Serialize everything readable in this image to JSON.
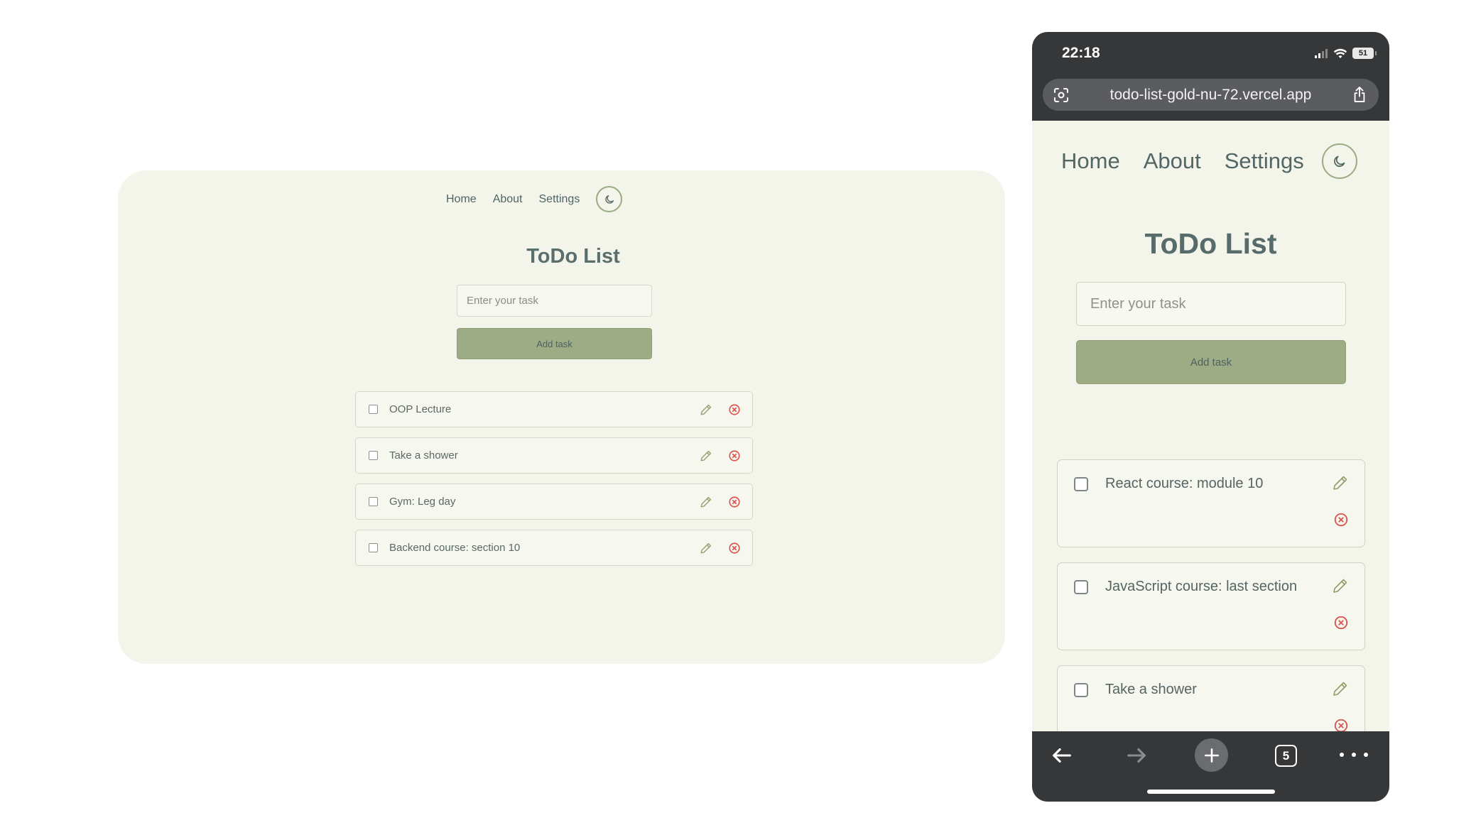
{
  "desktop": {
    "nav": {
      "home": "Home",
      "about": "About",
      "settings": "Settings"
    },
    "theme_toggle_icon": "moon-icon",
    "title": "ToDo List",
    "input_placeholder": "Enter your task",
    "add_button": "Add task",
    "tasks": [
      {
        "text": "OOP Lecture",
        "checked": false
      },
      {
        "text": "Take a shower",
        "checked": false
      },
      {
        "text": "Gym: Leg day",
        "checked": false
      },
      {
        "text": "Backend course: section 10",
        "checked": false
      }
    ]
  },
  "mobile": {
    "status_bar": {
      "time": "22:18",
      "battery": "51"
    },
    "browser": {
      "url": "todo-list-gold-nu-72.vercel.app",
      "tab_count": "5"
    },
    "nav": {
      "home": "Home",
      "about": "About",
      "settings": "Settings"
    },
    "theme_toggle_icon": "moon-icon",
    "title": "ToDo List",
    "input_placeholder": "Enter your task",
    "add_button": "Add task",
    "tasks": [
      {
        "text": "React course: module 10",
        "checked": false
      },
      {
        "text": "JavaScript course: last section",
        "checked": false
      },
      {
        "text": "Take a shower",
        "checked": false
      }
    ]
  },
  "colors": {
    "page_background": "#f4f5ea",
    "accent_green": "#9dac85",
    "text_slate": "#5b6e6e",
    "delete_red": "#d9534f",
    "edit_olive": "#8f9e6a",
    "browser_chrome": "#353739"
  }
}
